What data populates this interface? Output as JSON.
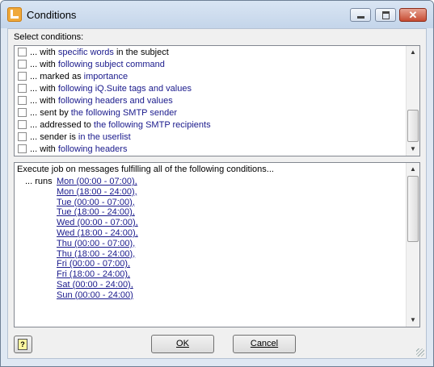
{
  "window": {
    "title": "Conditions"
  },
  "titlebar": {
    "close_glyph": "✕"
  },
  "select_label": "Select conditions:",
  "conditions": [
    {
      "prefix": "... with ",
      "link": "specific words",
      "suffix": " in the subject"
    },
    {
      "prefix": "... with ",
      "link": "following subject command",
      "suffix": ""
    },
    {
      "prefix": "... marked as ",
      "link": "importance",
      "suffix": ""
    },
    {
      "prefix": "... with ",
      "link": "following iQ.Suite tags and values",
      "suffix": ""
    },
    {
      "prefix": "... with ",
      "link": "following headers and values",
      "suffix": ""
    },
    {
      "prefix": "... sent by ",
      "link": "the following SMTP sender",
      "suffix": ""
    },
    {
      "prefix": "... addressed to ",
      "link": "the following SMTP recipients",
      "suffix": ""
    },
    {
      "prefix": "... sender is ",
      "link": "in the userlist",
      "suffix": ""
    },
    {
      "prefix": "... with ",
      "link": "following headers",
      "suffix": ""
    }
  ],
  "description": {
    "header": "Execute job on messages fulfilling all of the following conditions...",
    "runs_label": "... runs",
    "days": [
      "Mon (00:00 - 07:00),",
      "Mon (18:00 - 24:00),",
      "Tue (00:00 - 07:00),",
      "Tue (18:00 - 24:00),",
      "Wed (00:00 - 07:00),",
      "Wed (18:00 - 24:00),",
      "Thu (00:00 - 07:00),",
      "Thu (18:00 - 24:00),",
      "Fri (00:00 - 07:00),",
      "Fri (18:00 - 24:00),",
      "Sat (00:00 - 24:00),",
      "Sun (00:00 - 24:00)"
    ]
  },
  "buttons": {
    "ok": "OK",
    "cancel": "Cancel"
  },
  "scroll": {
    "up_glyph": "▲",
    "down_glyph": "▼"
  },
  "icons": {
    "help": "help-question-icon",
    "app": "app-logo-icon"
  },
  "colors": {
    "link": "#1a1a8c",
    "titlebar": "#c4d5ea",
    "close": "#c64b32"
  }
}
